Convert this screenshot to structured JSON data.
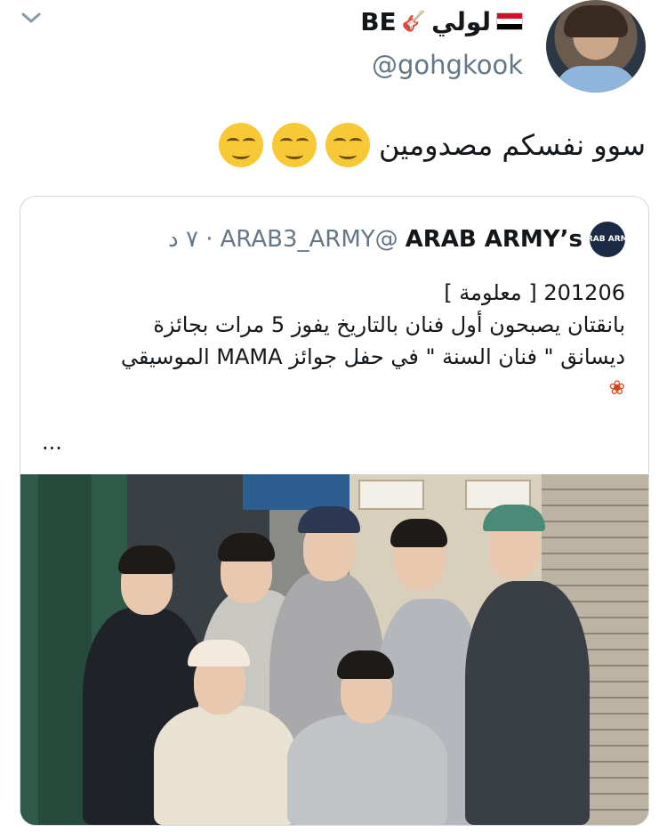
{
  "header": {
    "display_name": "لولي",
    "display_suffix": "BE",
    "handle": "@gohgkook",
    "chevron_icon": "chevron-down-icon",
    "flag_icon": "iraq-flag-icon",
    "guitar_icon": "guitar-icon"
  },
  "tweet": {
    "text": "سوو نفسكم مصدومين",
    "emoji": [
      "smirk-face-icon",
      "smirk-face-icon",
      "smirk-face-icon"
    ]
  },
  "quoted": {
    "name": "ARAB ARMY’s",
    "handle": "@ARAB3_ARMY",
    "time": "· ٧ د",
    "logo_text": "ARAB ARMY",
    "line1": "201206 [ معلومة ]",
    "line2": "بانقتان يصبحون أول فنان بالتاريخ يفوز 5 مرات بجائزة",
    "line3": "ديسانق \" فنان السنة \" في حفل جوائز MAMA الموسيقي",
    "more": "..."
  },
  "colors": {
    "text": "#14171a",
    "secondary": "#657786",
    "border": "#cfd9de"
  }
}
